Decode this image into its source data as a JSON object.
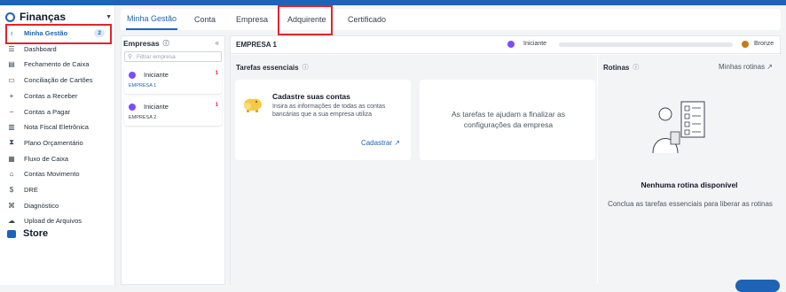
{
  "app": {
    "title": "Finanças"
  },
  "colors": {
    "primary": "#1e63b6",
    "highlight": "#e0252b",
    "level_purple": "#7c4dff",
    "bronze": "#c47a1e"
  },
  "sidebar": {
    "items": [
      {
        "label": "Minha Gestão",
        "icon": "award-icon",
        "badge": "2",
        "active": true
      },
      {
        "label": "Dashboard",
        "icon": "dashboard-icon"
      },
      {
        "label": "Fechamento de Caixa",
        "icon": "calendar-icon"
      },
      {
        "label": "Conciliação de Cartões",
        "icon": "card-icon"
      },
      {
        "label": "Contas a Receber",
        "icon": "plus-icon"
      },
      {
        "label": "Contas a Pagar",
        "icon": "minus-icon"
      },
      {
        "label": "Nota Fiscal Eletrônica",
        "icon": "barcode-icon"
      },
      {
        "label": "Plano Orçamentário",
        "icon": "hourglass-icon"
      },
      {
        "label": "Fluxo de Caixa",
        "icon": "flow-icon"
      },
      {
        "label": "Contas Movimento",
        "icon": "bank-icon"
      },
      {
        "label": "DRE",
        "icon": "dollar-icon"
      },
      {
        "label": "Diagnóstico",
        "icon": "diagnostic-icon"
      },
      {
        "label": "Upload de Arquivos",
        "icon": "cloud-upload-icon"
      }
    ],
    "store": "Store"
  },
  "tabs": [
    "Minha Gestão",
    "Conta",
    "Empresa",
    "Adquirente",
    "Certificado"
  ],
  "empresas": {
    "title": "Empresas",
    "search_placeholder": "Filtrar empresa",
    "items": [
      {
        "level": "Iniciante",
        "count": "1",
        "name": "EMPRESA 1",
        "selected": true
      },
      {
        "level": "Iniciante",
        "count": "1",
        "name": "EMPRESA 2",
        "selected": false
      }
    ]
  },
  "main": {
    "company": "EMPRESA 1",
    "current_level": "Iniciante",
    "next_level": "Bronze",
    "progress": 0,
    "tasks_title": "Tarefas essenciais",
    "card1": {
      "title": "Cadastre suas contas",
      "desc": "Insira as informações de todas as contas bancárias que a sua empresa utiliza",
      "link": "Cadastrar ↗"
    },
    "card2": {
      "text": "As tarefas te ajudam a finalizar as configurações da empresa"
    },
    "routines": {
      "title": "Rotinas",
      "link": "Minhas rotinas ↗",
      "empty": "Nenhuma rotina disponível",
      "sub": "Conclua as tarefas essenciais para liberar as rotinas"
    }
  }
}
